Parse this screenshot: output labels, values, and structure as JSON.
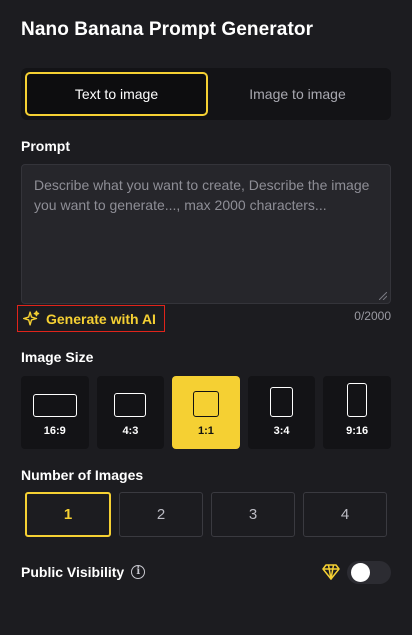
{
  "header": {
    "title": "Nano Banana Prompt Generator"
  },
  "mode_tabs": [
    {
      "label": "Text to image",
      "active": true
    },
    {
      "label": "Image to image",
      "active": false
    }
  ],
  "prompt": {
    "label": "Prompt",
    "placeholder": "Describe what you want to create, Describe the image you want to generate..., max 2000 characters...",
    "value": "",
    "counter": "0/2000"
  },
  "generate_ai": {
    "label": "Generate with AI",
    "icon": "sparkles-icon"
  },
  "image_size": {
    "label": "Image Size",
    "options": [
      {
        "ratio": "16:9",
        "active": false
      },
      {
        "ratio": "4:3",
        "active": false
      },
      {
        "ratio": "1:1",
        "active": true
      },
      {
        "ratio": "3:4",
        "active": false
      },
      {
        "ratio": "9:16",
        "active": false
      }
    ]
  },
  "num_images": {
    "label": "Number of Images",
    "options": [
      "1",
      "2",
      "3",
      "4"
    ],
    "selected": "1"
  },
  "visibility": {
    "label": "Public Visibility",
    "enabled": false,
    "premium_icon": "diamond-icon"
  },
  "colors": {
    "accent": "#f5d033",
    "background": "#1c1c20",
    "highlight_border": "#e0241b"
  }
}
